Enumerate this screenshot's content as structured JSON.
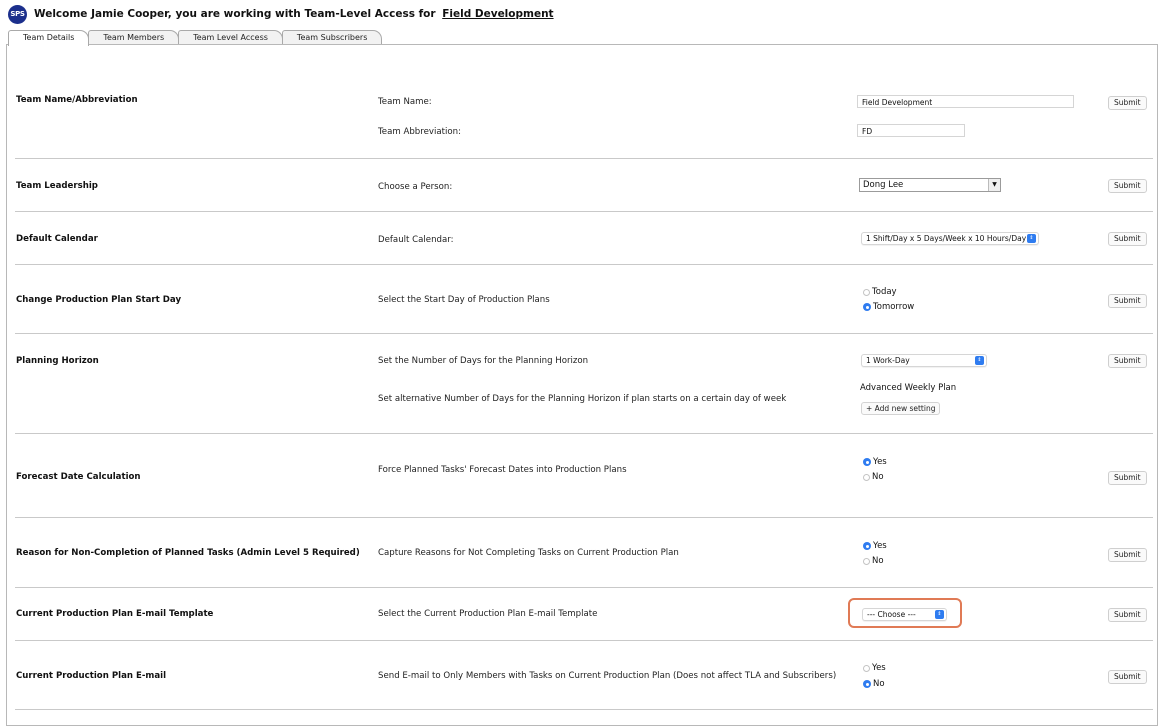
{
  "header": {
    "logo_text": "SPS",
    "welcome_text": "Welcome Jamie Cooper, you are working with Team-Level Access for",
    "team_link": "Field Development"
  },
  "tabs": [
    {
      "label": "Team Details",
      "active": true
    },
    {
      "label": "Team Members",
      "active": false
    },
    {
      "label": "Team Level Access",
      "active": false
    },
    {
      "label": "Team Subscribers",
      "active": false
    }
  ],
  "sections": {
    "name_abbr": {
      "title": "Team Name/Abbreviation",
      "name_label": "Team Name:",
      "name_value": "Field Development",
      "abbr_label": "Team Abbreviation:",
      "abbr_value": "FD",
      "submit": "Submit"
    },
    "leadership": {
      "title": "Team Leadership",
      "label": "Choose a Person:",
      "selected": "Dong Lee",
      "submit": "Submit"
    },
    "calendar": {
      "title": "Default Calendar",
      "label": "Default Calendar:",
      "selected": "1 Shift/Day x 5 Days/Week x 10 Hours/Day",
      "submit": "Submit"
    },
    "start_day": {
      "title": "Change Production Plan Start Day",
      "label": "Select the Start Day of Production Plans",
      "options": [
        {
          "label": "Today",
          "checked": false
        },
        {
          "label": "Tomorrow",
          "checked": true
        }
      ],
      "submit": "Submit"
    },
    "horizon": {
      "title": "Planning Horizon",
      "label": "Set the Number of Days for the Planning Horizon",
      "selected": "1 Work-Day",
      "alt_label": "Set alternative Number of Days for the Planning Horizon if plan starts on a certain day of week",
      "advanced_label": "Advanced Weekly Plan",
      "add_setting": "+ Add new setting",
      "submit": "Submit"
    },
    "forecast": {
      "title": "Forecast Date Calculation",
      "label": "Force Planned Tasks' Forecast Dates into Production Plans",
      "options": [
        {
          "label": "Yes",
          "checked": true
        },
        {
          "label": "No",
          "checked": false
        }
      ],
      "submit": "Submit"
    },
    "reason": {
      "title": "Reason for Non-Completion of Planned Tasks (Admin Level 5 Required)",
      "label": "Capture Reasons for Not Completing Tasks on Current Production Plan",
      "options": [
        {
          "label": "Yes",
          "checked": true
        },
        {
          "label": "No",
          "checked": false
        }
      ],
      "submit": "Submit"
    },
    "email_template": {
      "title": "Current Production Plan E-mail Template",
      "label": "Select the Current Production Plan E-mail Template",
      "selected": "--- Choose ---",
      "submit": "Submit"
    },
    "email": {
      "title": "Current Production Plan E-mail",
      "label": "Send E-mail to Only Members with Tasks on Current Production Plan (Does not affect TLA and Subscribers)",
      "options": [
        {
          "label": "Yes",
          "checked": false
        },
        {
          "label": "No",
          "checked": true
        }
      ],
      "submit": "Submit"
    }
  },
  "colors": {
    "logo_bg": "#1b2f8c",
    "accent_blue": "#2f7cf0",
    "highlight": "#e07a55"
  }
}
